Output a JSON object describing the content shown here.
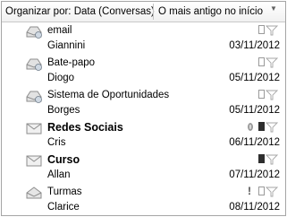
{
  "header": {
    "sort_label": "Organizar por: Data (Conversas)",
    "order_label": "O mais antigo no início"
  },
  "messages": [
    {
      "subject": "email",
      "from": "Giannini",
      "date": "03/11/2012",
      "icon": "conversation-read-icon",
      "unread": false
    },
    {
      "subject": "Bate-papo",
      "from": "Diogo",
      "date": "05/11/2012",
      "icon": "conversation-read-icon",
      "unread": false
    },
    {
      "subject": "Sistema de Oportunidades",
      "from": "Borges",
      "date": "05/11/2012",
      "icon": "conversation-read-icon",
      "unread": false
    },
    {
      "subject": "Redes Sociais",
      "from": "Cris",
      "date": "06/11/2012",
      "icon": "envelope-unread-icon",
      "unread": true,
      "attachment": true
    },
    {
      "subject": "Curso",
      "from": "Allan",
      "date": "07/11/2012",
      "icon": "envelope-unread-icon",
      "unread": true
    },
    {
      "subject": "Turmas",
      "from": "Clarice",
      "date": "08/11/2012",
      "icon": "envelope-open-icon",
      "unread": false,
      "importance": "!"
    }
  ]
}
